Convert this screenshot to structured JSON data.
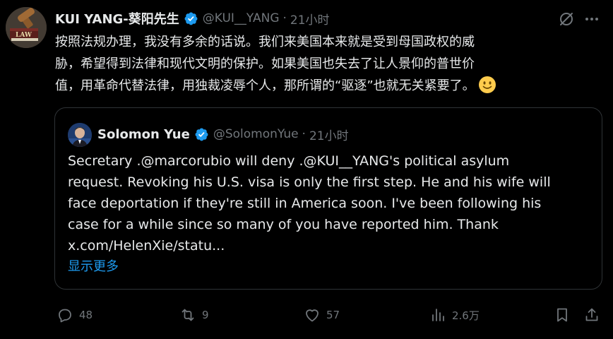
{
  "post": {
    "author_name": "KUI YANG-葵阳先生",
    "handle": "@KUI__YANG",
    "separator": "·",
    "time": "21小时",
    "text_lines": [
      "按照法规办理，我没有多余的话说。我们来美国本来就是受到母国政权的威",
      "胁，希望得到法律和现代文明的保护。如果美国也失去了让人景仰的普世价",
      "值，用革命代替法律，用独裁凌辱个人，那所谓的“驱逐”也就无关紧要了。"
    ],
    "avatar_lettering": "LAW"
  },
  "quote": {
    "author_name": "Solomon Yue",
    "handle": "@SolomonYue",
    "separator": "·",
    "time": "21小时",
    "text_lines": [
      "Secretary .@marcorubio will deny .@KUI__YANG's political asylum",
      "request. Revoking his U.S. visa is only the first step. He and his wife will",
      "face deportation if they're still in America soon. I've been following his",
      "case for a while since so many of you have reported him. Thank",
      "x.com/HelenXie/statu..."
    ],
    "show_more": "显示更多"
  },
  "actions": {
    "replies": "48",
    "reposts": "9",
    "likes": "57",
    "views": "2.6万"
  },
  "colors": {
    "background": "#000000",
    "text_primary": "#e7e9ea",
    "text_secondary": "#71767b",
    "accent": "#1d9bf0",
    "border": "#2f3336",
    "verified": "#1d9bf0"
  },
  "icons": {
    "verified": "verified-badge-icon",
    "grok": "grok-icon",
    "more": "more-icon",
    "reply": "reply-icon",
    "repost": "repost-icon",
    "like": "heart-icon",
    "views": "views-icon",
    "bookmark": "bookmark-icon",
    "share": "share-icon",
    "emoji": "slightly-smiling-face-emoji"
  }
}
